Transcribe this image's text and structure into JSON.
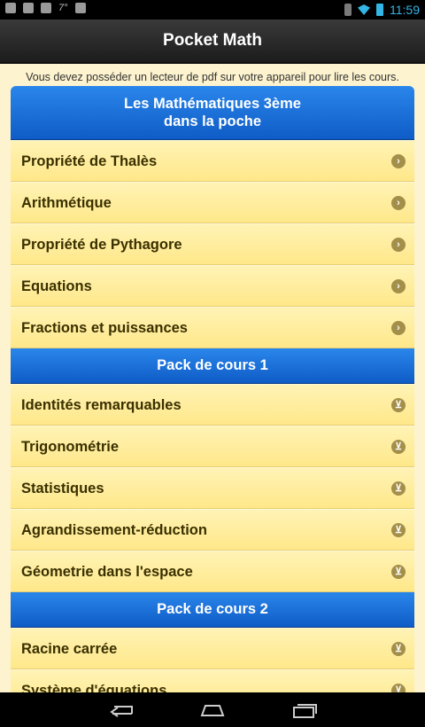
{
  "status": {
    "time": "11:59",
    "carrier_label": "7°"
  },
  "app": {
    "title": "Pocket Math"
  },
  "notice": "Vous devez posséder un lecteur de pdf sur votre appareil pour lire les cours.",
  "sections": [
    {
      "title_line1": "Les Mathématiques 3ème",
      "title_line2": "dans la poche",
      "item_icon": "arrow-right-icon",
      "items": [
        "Propriété de Thalès",
        "Arithmétique",
        "Propriété de Pythagore",
        "Equations",
        "Fractions et puissances"
      ]
    },
    {
      "title": "Pack de cours 1",
      "item_icon": "cart-icon",
      "items": [
        "Identités remarquables",
        "Trigonométrie",
        "Statistiques",
        "Agrandissement-réduction",
        "Géometrie dans l'espace"
      ]
    },
    {
      "title": "Pack de cours 2",
      "item_icon": "cart-icon",
      "items": [
        "Racine carrée",
        "Système d'équations"
      ]
    }
  ],
  "nav": {
    "back": "back-icon",
    "home": "home-icon",
    "recents": "recents-icon"
  },
  "colors": {
    "header_blue": "#1565d8",
    "row_yellow": "#ffe88a",
    "status_accent": "#33b5e5"
  }
}
